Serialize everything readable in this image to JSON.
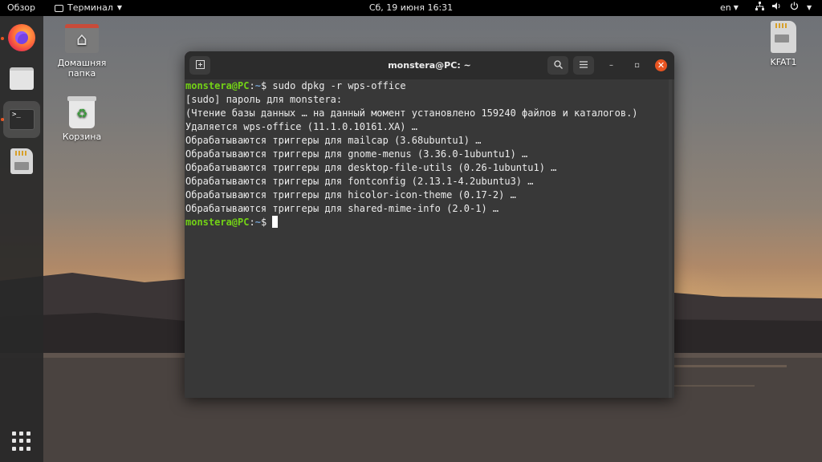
{
  "topbar": {
    "overview_label": "Обзор",
    "app_menu_label": "Терминал",
    "clock": "Сб, 19 июня  16:31",
    "language": "en",
    "icons": [
      "network-icon",
      "volume-icon",
      "power-icon"
    ]
  },
  "dock": {
    "items": [
      {
        "name": "firefox",
        "icon": "firefox-icon",
        "running": true
      },
      {
        "name": "files",
        "icon": "files-icon",
        "running": false
      },
      {
        "name": "terminal",
        "icon": "terminal-icon",
        "running": true,
        "active": true
      },
      {
        "name": "sd-card",
        "icon": "sd-card-icon",
        "running": false
      }
    ],
    "show_apps_icon": "apps-grid-icon"
  },
  "desktop": {
    "home_label": "Домашняя папка",
    "trash_label": "Корзина",
    "drive_label": "KFAT1"
  },
  "terminal": {
    "title": "monstera@PC: ~",
    "prompt_user": "monstera@PC",
    "prompt_sep": ":",
    "prompt_path": "~",
    "prompt_sign": "$",
    "command": " sudo dpkg -r wps-office",
    "output": [
      "[sudo] пароль для monstera:",
      "(Чтение базы данных … на данный момент установлено 159240 файлов и каталогов.)",
      "Удаляется wps-office (11.1.0.10161.XA) …",
      "Обрабатываются триггеры для mailcap (3.68ubuntu1) …",
      "Обрабатываются триггеры для gnome-menus (3.36.0-1ubuntu1) …",
      "Обрабатываются триггеры для desktop-file-utils (0.26-1ubuntu1) …",
      "Обрабатываются триггеры для fontconfig (2.13.1-4.2ubuntu3) …",
      "Обрабатываются триггеры для hicolor-icon-theme (0.17-2) …",
      "Обрабатываются триггеры для shared-mime-info (2.0-1) …"
    ],
    "colors": {
      "user": "#73d216",
      "path": "#729fcf",
      "bg": "#383838",
      "close": "#e95420"
    }
  }
}
